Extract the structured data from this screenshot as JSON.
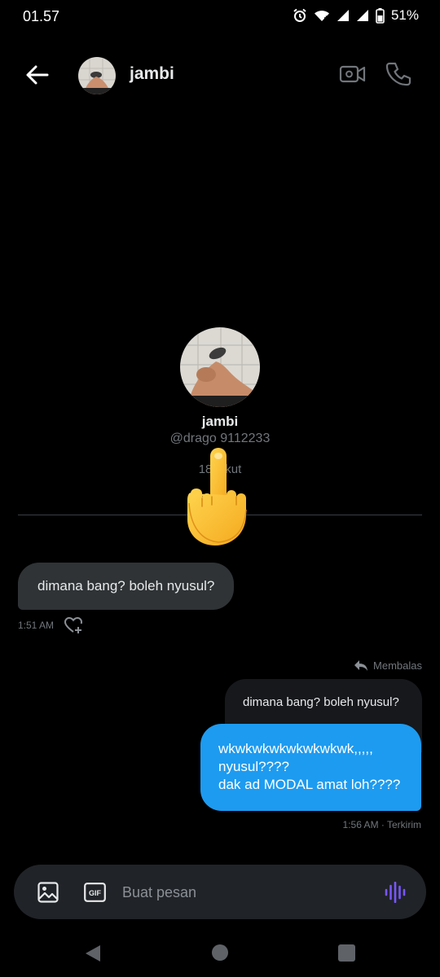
{
  "status": {
    "time": "01.57",
    "battery": "51%",
    "icons": [
      "alarm-icon",
      "wifi-icon",
      "signal-icon",
      "signal-icon",
      "battery-icon"
    ]
  },
  "header": {
    "name": "jambi",
    "icons": [
      "back-arrow-icon",
      "video-call-icon",
      "phone-icon"
    ]
  },
  "profile": {
    "name": "jambi",
    "handle": "@drago   9112233",
    "followers": "18       gikut"
  },
  "date_label": "H",
  "messages": [
    {
      "direction": "incoming",
      "text": "dimana bang? boleh nyusul?",
      "time": "1:51 AM"
    },
    {
      "direction": "outgoing",
      "reply_label": "Membalas",
      "quoted_text": "dimana bang? boleh nyusul?",
      "lines": [
        "wkwkwkwkwkwkwkwk,,,,,",
        "nyusul????",
        "dak ad MODAL amat loh????"
      ],
      "meta": "1:56 AM · Terkirim"
    }
  ],
  "composer": {
    "placeholder": "Buat pesan",
    "value": "",
    "icons": [
      "image-icon",
      "gif-icon",
      "voice-wave-icon"
    ]
  },
  "colors": {
    "background": "#000000",
    "accent": "#1d9bf0",
    "incoming_bubble": "#2f3336",
    "voice_icon": "#7856ff"
  }
}
